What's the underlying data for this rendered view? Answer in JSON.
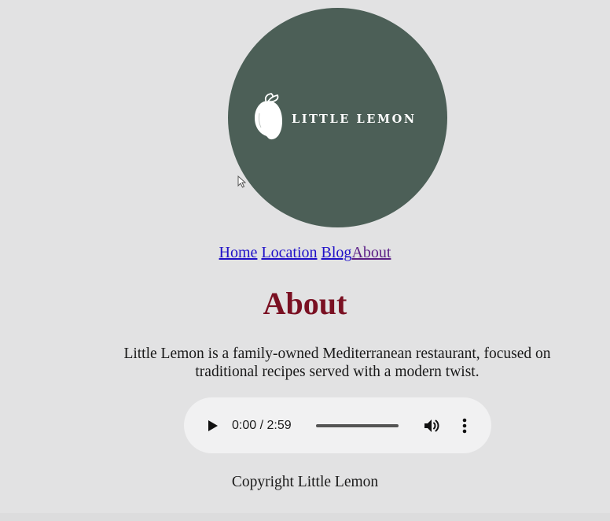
{
  "logo": {
    "text": "LITTLE LEMON",
    "circle_color": "#4c5f57",
    "lemon_icon": "lemon-icon"
  },
  "nav": {
    "links": [
      {
        "label": "Home",
        "color": "#1f10c8"
      },
      {
        "label": "Location",
        "color": "#1f10c8"
      },
      {
        "label": "Blog",
        "color": "#1f10c8"
      },
      {
        "label": "About",
        "color": "#5b1f86"
      }
    ]
  },
  "main": {
    "title": "About",
    "title_color": "#7a1022",
    "description": "Little Lemon is a family-owned Mediterranean restaurant, focused on traditional recipes served with a modern twist."
  },
  "audio": {
    "time_display": "0:00 / 2:59",
    "current_time": "0:00",
    "duration": "2:59",
    "progress": 0,
    "icons": [
      "play-icon",
      "volume-icon",
      "more-vertical-icon"
    ]
  },
  "footer": {
    "copyright": "Copyright Little Lemon"
  },
  "colors": {
    "background": "#e2e2e3",
    "player_background": "#f1f1f2"
  }
}
